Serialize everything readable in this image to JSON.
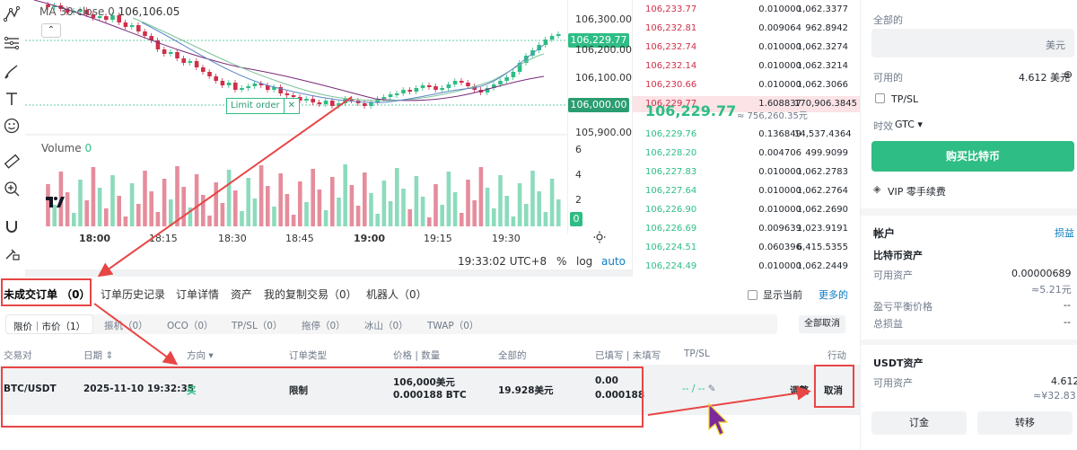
{
  "chart": {
    "ma_label": "MA 30 close 0",
    "ma_value": "106,106.05",
    "price_ticks": [
      "106,300.00",
      "106,200.00",
      "106,100.00",
      "105,900.00"
    ],
    "current_price_tag": "106,229.77",
    "limit_price_tag": "106,000.00",
    "limit_order_label": "Limit order",
    "limit_order_close": "✕",
    "volume_label": "Volume",
    "volume_value": "0",
    "volume_ticks": [
      "6",
      "4",
      "2",
      "0"
    ],
    "time_ticks": [
      "18:00",
      "18:15",
      "18:30",
      "18:45",
      "19:00",
      "19:15",
      "19:30"
    ],
    "clock": "19:33:02 UTC+8",
    "pct": "%",
    "log": "log",
    "auto": "auto",
    "colors": {
      "up": "#2ebd85",
      "down": "#cf304a",
      "ma1": "#7a2a78",
      "ma2": "#7fc19a",
      "ma3": "#5b87c7"
    }
  },
  "book": {
    "asks": [
      {
        "price": "106,233.77",
        "amount": "0.010000",
        "total": "1,062.3377"
      },
      {
        "price": "106,232.81",
        "amount": "0.009064",
        "total": "962.8942"
      },
      {
        "price": "106,232.74",
        "amount": "0.010000",
        "total": "1,062.3274"
      },
      {
        "price": "106,232.14",
        "amount": "0.010000",
        "total": "1,062.3214"
      },
      {
        "price": "106,230.66",
        "amount": "0.010000",
        "total": "1,062.3066"
      },
      {
        "price": "106,229.77",
        "amount": "1.608837",
        "total": "170,906.3845"
      }
    ],
    "last_price": "106,229.77",
    "last_fiat": "≈ 756,260.35元",
    "bids": [
      {
        "price": "106,229.76",
        "amount": "0.136849",
        "total": "14,537.4364"
      },
      {
        "price": "106,228.20",
        "amount": "0.004706",
        "total": "499.9099"
      },
      {
        "price": "106,227.83",
        "amount": "0.010000",
        "total": "1,062.2783"
      },
      {
        "price": "106,227.64",
        "amount": "0.010000",
        "total": "1,062.2764"
      },
      {
        "price": "106,226.90",
        "amount": "0.010000",
        "total": "1,062.2690"
      },
      {
        "price": "106,226.69",
        "amount": "0.009639",
        "total": "1,023.9191"
      },
      {
        "price": "106,224.51",
        "amount": "0.060396",
        "total": "6,415.5355"
      },
      {
        "price": "106,224.49",
        "amount": "0.010000",
        "total": "1,062.2449"
      },
      {
        "price": "106,224.47",
        "amount": "0.010000",
        "total": "1,062.2447"
      }
    ]
  },
  "trade": {
    "total_label": "全部的",
    "amount_unit": "美元",
    "available_label": "可用的",
    "available_value": "4.612 美元",
    "tpsl_label": "TP/SL",
    "tif_label": "时效",
    "tif_value": "GTC",
    "buy_button": "购买比特币",
    "vip_label": "VIP 零手续费"
  },
  "account": {
    "title": "帐户",
    "pnl_link": "损益",
    "btc_title": "比特币资产",
    "btc_available_label": "可用资产",
    "btc_available_value": "0.00000689",
    "btc_available_fiat": "≈5.21元",
    "breakeven_label": "盈亏平衡价格",
    "breakeven_value": "--",
    "total_pnl_label": "总损益",
    "total_pnl_value": "--",
    "usdt_title": "USDT资产",
    "usdt_available_label": "可用资产",
    "usdt_available_value": "4.612",
    "usdt_available_fiat": "≈¥32.83",
    "deposit_button": "订金",
    "transfer_button": "转移"
  },
  "orders": {
    "tabs": [
      "未成交订单 （0）",
      "订单历史记录",
      "订单详情",
      "资产",
      "我的复制交易（0）",
      "机器人（0）"
    ],
    "show_current": "显示当前",
    "more": "更多的",
    "subtabs": [
      "限价｜市价（1）",
      "振机（0）",
      "OCO（0）",
      "TP/SL（0）",
      "拖停（0）",
      "冰山（0）",
      "TWAP（0）"
    ],
    "cancel_all": "全部取消",
    "columns": [
      "交易对",
      "日期",
      "方向",
      "订单类型",
      "价格 | 数量",
      "全部的",
      "已填写 | 未填写",
      "TP/SL",
      "行动"
    ],
    "row": {
      "pair": "BTC/USDT",
      "date": "2025-11-10 19:32:35",
      "side": "买",
      "type": "限制",
      "price": "106,000美元",
      "qty": "0.000188 BTC",
      "total": "19.928美元",
      "filled": "0.00",
      "unfilled": "0.000188",
      "tpsl": "-- / --",
      "adjust": "调整",
      "cancel": "取消"
    }
  }
}
